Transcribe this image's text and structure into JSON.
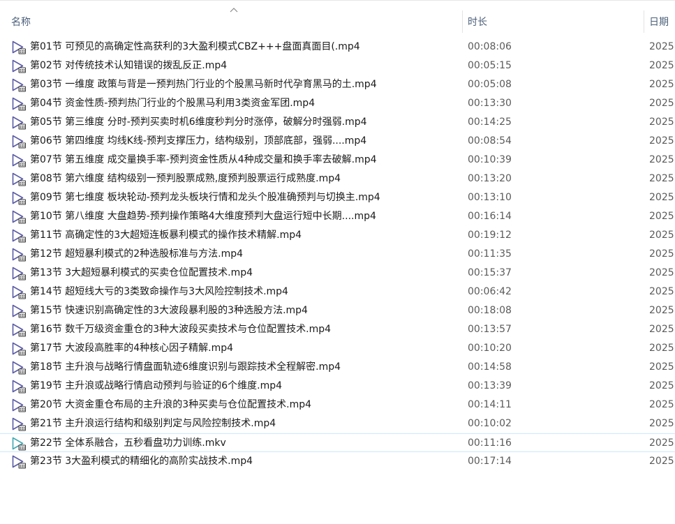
{
  "columns": {
    "name": "名称",
    "duration": "时长",
    "date": "日期"
  },
  "icons": {
    "sort": "chevron-up-icon",
    "mp4": "video-file-icon",
    "mkv": "video-file-icon-alt"
  },
  "colors": {
    "icon_purple": "#5b5ba6",
    "icon_teal": "#3fa7b1",
    "header_text": "#4c607a",
    "selection_border": "#cce8ff"
  },
  "files": [
    {
      "name": "第01节 可预见的高确定性高获利的3大盈利模式CBZ+++盘面真面目(.mp4",
      "duration": "00:08:06",
      "date": "2025",
      "type": "mp4"
    },
    {
      "name": "第02节 对传统技术认知错误的拨乱反正.mp4",
      "duration": "00:05:15",
      "date": "2025",
      "type": "mp4"
    },
    {
      "name": "第03节 一维度 政策与背是一预判热门行业的个股黑马新时代孕育黑马的土.mp4",
      "duration": "00:05:08",
      "date": "2025",
      "type": "mp4"
    },
    {
      "name": "第04节 资金性质-预判热门行业的个股黑马利用3类资金军团.mp4",
      "duration": "00:13:30",
      "date": "2025",
      "type": "mp4"
    },
    {
      "name": "第05节 第三维度 分时-预判买卖时机6维度秒判分时涨停，破解分时强弱.mp4",
      "duration": "00:14:25",
      "date": "2025",
      "type": "mp4"
    },
    {
      "name": "第06节 第四维度 均线K线-预判支撑压力，结构级别，顶部底部，强弱....mp4",
      "duration": "00:08:54",
      "date": "2025",
      "type": "mp4"
    },
    {
      "name": "第07节 第五维度 成交量换手率-预判资金性质从4种成交量和换手率去破解.mp4",
      "duration": "00:10:39",
      "date": "2025",
      "type": "mp4"
    },
    {
      "name": "第08节 第六维度 结构级别一预判股票成熟,度预判股票运行成熟度.mp4",
      "duration": "00:13:20",
      "date": "2025",
      "type": "mp4"
    },
    {
      "name": "第09节 第七维度 板块轮动-预判龙头板块行情和龙头个股准确预判与切换主.mp4",
      "duration": "00:13:10",
      "date": "2025",
      "type": "mp4"
    },
    {
      "name": "第10节 第八维度 大盘趋势-预判操作策略4大维度预判大盘运行短中长期....mp4",
      "duration": "00:16:14",
      "date": "2025",
      "type": "mp4"
    },
    {
      "name": "第11节 高确定性的3大超短连板暴利模式的操作技术精解.mp4",
      "duration": "00:19:12",
      "date": "2025",
      "type": "mp4"
    },
    {
      "name": "第12节 超短暴利模式的2种选股标准与方法.mp4",
      "duration": "00:11:35",
      "date": "2025",
      "type": "mp4"
    },
    {
      "name": "第13节 3大超短暴利模式的买卖仓位配置技术.mp4",
      "duration": "00:15:37",
      "date": "2025",
      "type": "mp4"
    },
    {
      "name": "第14节 超短线大亏的3类致命操作与3大风险控制技术.mp4",
      "duration": "00:06:42",
      "date": "2025",
      "type": "mp4"
    },
    {
      "name": "第15节 快速识别高确定性的3大波段暴利股的3种选股方法.mp4",
      "duration": "00:18:08",
      "date": "2025",
      "type": "mp4"
    },
    {
      "name": "第16节 数千万级资金重仓的3种大波段买卖技术与仓位配置技术.mp4",
      "duration": "00:13:57",
      "date": "2025",
      "type": "mp4"
    },
    {
      "name": "第17节 大波段高胜率的4种核心因子精解.mp4",
      "duration": "00:10:20",
      "date": "2025",
      "type": "mp4"
    },
    {
      "name": "第18节 主升浪与战略行情盘面轨迹6维度识别与跟踪技术全程解密.mp4",
      "duration": "00:14:58",
      "date": "2025",
      "type": "mp4"
    },
    {
      "name": "第19节 主升浪或战略行情启动预判与验证的6个维度.mp4",
      "duration": "00:13:39",
      "date": "2025",
      "type": "mp4"
    },
    {
      "name": "第20节 大资金重仓布局的主升浪的3种买卖与仓位配置技术.mp4",
      "duration": "00:14:11",
      "date": "2025",
      "type": "mp4"
    },
    {
      "name": "第21节 主升浪运行结构和级别判定与风险控制技术.mp4",
      "duration": "00:10:02",
      "date": "2025",
      "type": "mp4"
    },
    {
      "name": "第22节 全体系融合，五秒看盘功力训练.mkv",
      "duration": "00:11:16",
      "date": "2025",
      "type": "mkv",
      "selected": true
    },
    {
      "name": "第23节 3大盈利模式的精细化的高阶实战技术.mp4",
      "duration": "00:17:14",
      "date": "2025",
      "type": "mp4"
    }
  ]
}
